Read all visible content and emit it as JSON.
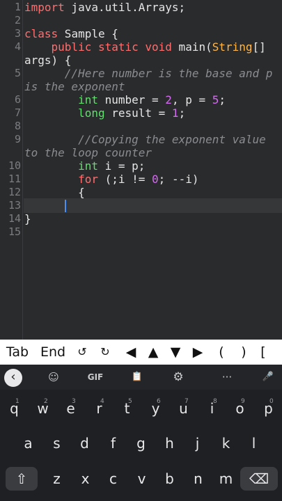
{
  "editor": {
    "line_numbers": [
      "1",
      "2",
      "3",
      "4",
      "5",
      "6",
      "7",
      "8",
      "9",
      "10",
      "11",
      "12",
      "13",
      "14",
      "15"
    ],
    "lines": [
      {
        "id": "l1",
        "tokens": [
          [
            "kw",
            "import"
          ],
          [
            "pl",
            " java.util.Arrays;"
          ]
        ]
      },
      {
        "id": "l3",
        "tokens": [
          [
            "kw",
            "class"
          ],
          [
            "pl",
            " Sample {"
          ]
        ]
      },
      {
        "id": "l4a",
        "tokens": [
          [
            "pl",
            "    "
          ],
          [
            "kw",
            "public static void"
          ],
          [
            "pl",
            " main("
          ],
          [
            "cls",
            "String"
          ],
          [
            "pl",
            "[]"
          ]
        ]
      },
      {
        "id": "l4b",
        "tokens": [
          [
            "pl",
            "args) {"
          ]
        ]
      },
      {
        "id": "l5a",
        "tokens": [
          [
            "cm",
            "      //Here number is the base and p"
          ]
        ]
      },
      {
        "id": "l5b",
        "tokens": [
          [
            "cm",
            "is the exponent"
          ]
        ]
      },
      {
        "id": "l6",
        "tokens": [
          [
            "pl",
            "        "
          ],
          [
            "ty",
            "int"
          ],
          [
            "pl",
            " number = "
          ],
          [
            "num",
            "2"
          ],
          [
            "pl",
            ", p = "
          ],
          [
            "num",
            "5"
          ],
          [
            "pl",
            ";"
          ]
        ]
      },
      {
        "id": "l7",
        "tokens": [
          [
            "pl",
            "        "
          ],
          [
            "ty",
            "long"
          ],
          [
            "pl",
            " result = "
          ],
          [
            "num",
            "1"
          ],
          [
            "pl",
            ";"
          ]
        ]
      },
      {
        "id": "l9a",
        "tokens": [
          [
            "cm",
            "        //Copying the exponent value"
          ]
        ]
      },
      {
        "id": "l9b",
        "tokens": [
          [
            "cm",
            "to the loop counter"
          ]
        ]
      },
      {
        "id": "l10",
        "tokens": [
          [
            "pl",
            "        "
          ],
          [
            "ty",
            "int"
          ],
          [
            "pl",
            " i = p;"
          ]
        ]
      },
      {
        "id": "l11",
        "tokens": [
          [
            "pl",
            "        "
          ],
          [
            "kw",
            "for"
          ],
          [
            "pl",
            " (;i != "
          ],
          [
            "num",
            "0"
          ],
          [
            "pl",
            "; --i)"
          ]
        ]
      },
      {
        "id": "l12",
        "tokens": [
          [
            "pl",
            "        {"
          ]
        ]
      },
      {
        "id": "l14",
        "tokens": [
          [
            "pl",
            "}"
          ]
        ]
      }
    ]
  },
  "extra_keys": [
    "Tab",
    "End",
    "↺",
    "↻",
    "◀",
    "▲",
    "▼",
    "▶",
    "(",
    ")",
    "["
  ],
  "keyboard": {
    "toolbar": {
      "back": "‹",
      "sticker": "☺",
      "gif": "GIF",
      "clipboard": "📋",
      "settings": "⚙",
      "more": "···",
      "mic": "🎤"
    },
    "row1": [
      {
        "k": "q",
        "h": "1"
      },
      {
        "k": "w",
        "h": "2"
      },
      {
        "k": "e",
        "h": "3"
      },
      {
        "k": "r",
        "h": "4"
      },
      {
        "k": "t",
        "h": "5"
      },
      {
        "k": "y",
        "h": "6"
      },
      {
        "k": "u",
        "h": "7"
      },
      {
        "k": "i",
        "h": "8"
      },
      {
        "k": "o",
        "h": "9"
      },
      {
        "k": "p",
        "h": "0"
      }
    ],
    "row2": [
      "a",
      "s",
      "d",
      "f",
      "g",
      "h",
      "j",
      "k",
      "l"
    ],
    "row3": [
      "z",
      "x",
      "c",
      "v",
      "b",
      "n",
      "m"
    ],
    "shift": "⇧",
    "backspace": "⌫"
  },
  "colors": {
    "keyword": "#ff6e6e",
    "type": "#5ee06a",
    "number": "#d36cf0",
    "class": "#ffb74a",
    "comment": "#8a8c90",
    "caret": "#4a8ff5"
  }
}
